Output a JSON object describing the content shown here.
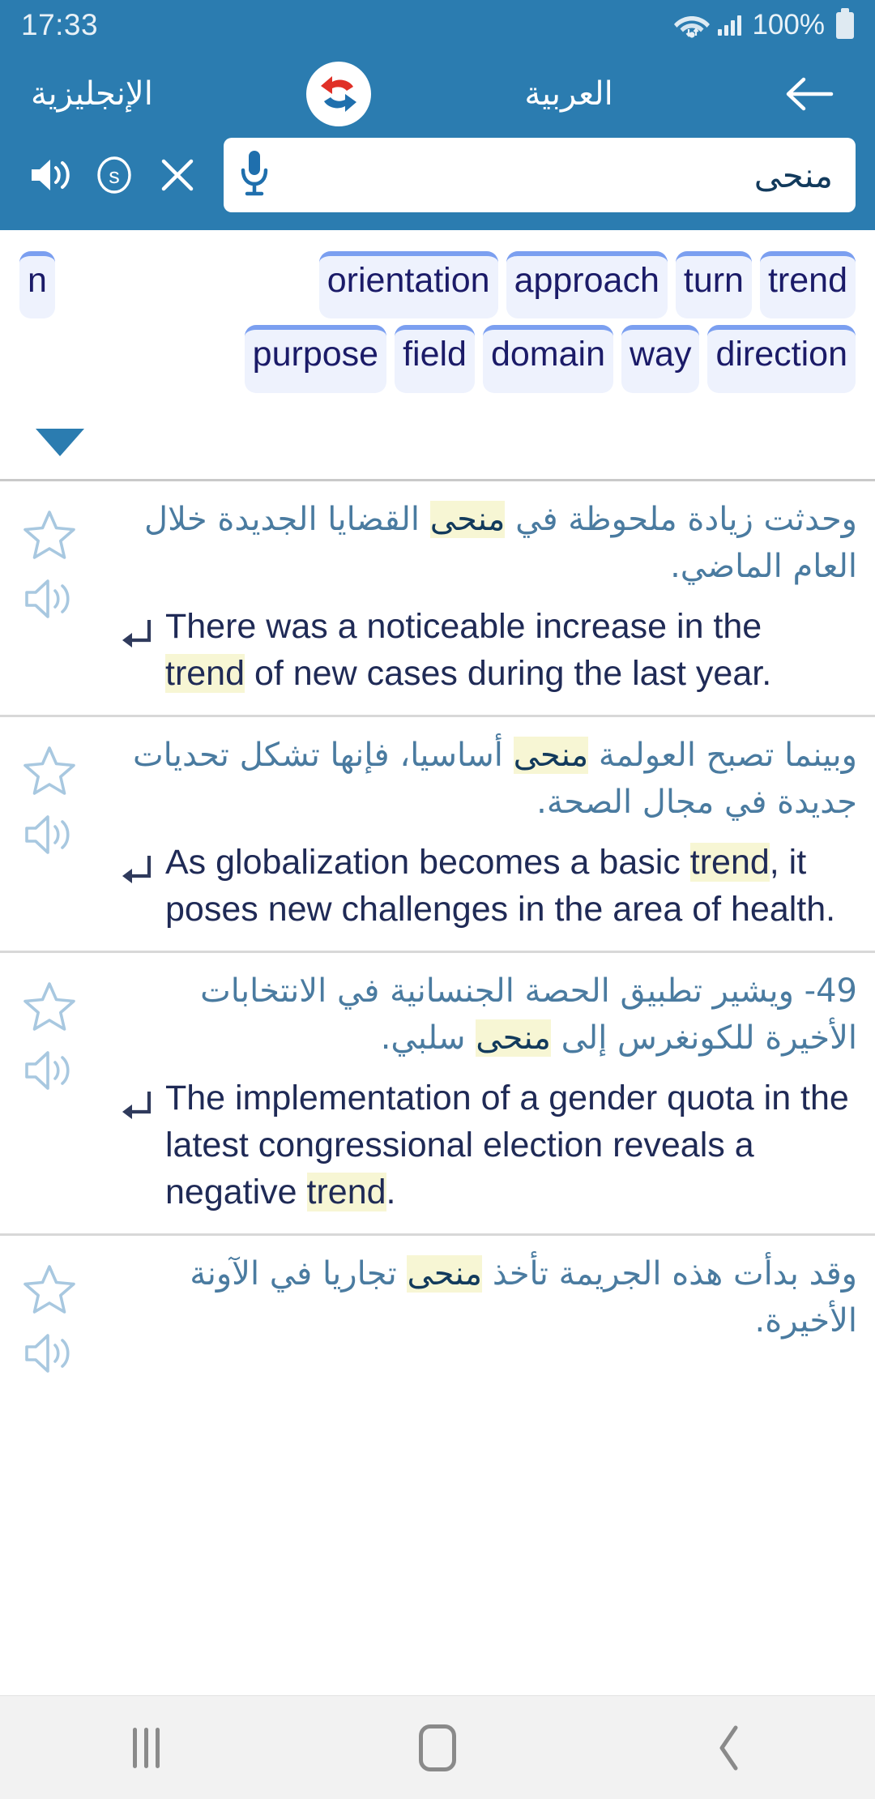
{
  "status_bar": {
    "time": "17:33",
    "battery_percent": "100%",
    "icons": [
      "wifi-icon",
      "signal-icon",
      "battery-icon"
    ]
  },
  "app_bar": {
    "back_icon": "back-arrow-icon",
    "source_language": "العربية",
    "target_language": "الإنجليزية",
    "swap_logo": "swap-languages-logo",
    "brand_colors": {
      "header": "#2b7cb0",
      "logo_red": "#e03027",
      "logo_blue": "#1f6fad"
    }
  },
  "search": {
    "query": "منحى",
    "placeholder": "منحى",
    "mic_icon": "microphone-icon",
    "clear_icon": "close-x-icon",
    "synonym_icon": "s-circle-icon",
    "speaker_icon": "speaker-icon"
  },
  "translations": {
    "part_of_speech": "n",
    "row1": [
      "orientation",
      "approach",
      "turn",
      "trend"
    ],
    "row2": [
      "purpose",
      "field",
      "domain",
      "way",
      "direction"
    ],
    "expand_icon": "chevron-down-icon",
    "chip_colors": {
      "fill": "#eef2fd",
      "top_border": "#7b9ff0",
      "text": "#1b1b68"
    }
  },
  "examples": [
    {
      "arabic_pre": "وحدثت زيادة ملحوظة في ",
      "arabic_hl": "منحى",
      "arabic_post": " القضايا الجديدة خلال العام الماضي.",
      "english_pre": "There was a noticeable increase in the ",
      "english_hl": "trend",
      "english_post": " of new cases during the last year.",
      "star_icon": "star-outline-icon",
      "speaker_icon": "speaker-outline-icon",
      "return_icon": "return-arrow-icon"
    },
    {
      "arabic_pre": "وبينما تصبح العولمة ",
      "arabic_hl": "منحى",
      "arabic_post": " أساسيا، فإنها تشكل تحديات جديدة في مجال الصحة.",
      "english_pre": "As globalization becomes a basic ",
      "english_hl": "trend",
      "english_post": ", it poses new challenges in the area of health.",
      "star_icon": "star-outline-icon",
      "speaker_icon": "speaker-outline-icon",
      "return_icon": "return-arrow-icon"
    },
    {
      "arabic_pre": "49- ويشير تطبيق الحصة الجنسانية في الانتخابات الأخيرة للكونغرس إلى ",
      "arabic_hl": "منحى",
      "arabic_post": " سلبي.",
      "english_pre": "The implementation of a gender quota in the latest congressional election reveals a negative ",
      "english_hl": "trend",
      "english_post": ".",
      "star_icon": "star-outline-icon",
      "speaker_icon": "speaker-outline-icon",
      "return_icon": "return-arrow-icon"
    },
    {
      "arabic_pre": "وقد بدأت هذه الجريمة تأخذ ",
      "arabic_hl": "منحى",
      "arabic_post": " تجاريا في الآونة الأخيرة.",
      "english_pre": "",
      "english_hl": "",
      "english_post": "",
      "star_icon": "star-outline-icon",
      "speaker_icon": "speaker-outline-icon",
      "return_icon": "return-arrow-icon"
    }
  ],
  "nav_bar": {
    "recents_icon": "recents-icon",
    "home_icon": "home-icon",
    "back_icon": "back-chevron-icon"
  }
}
